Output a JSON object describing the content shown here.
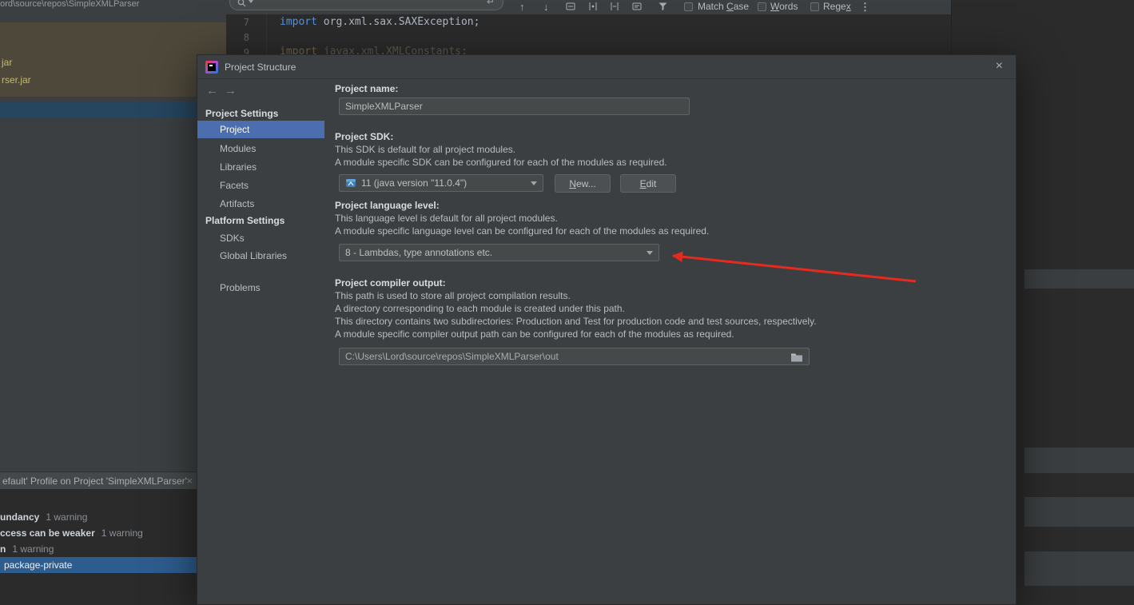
{
  "colors": {
    "panel_bg": "#3c3f41",
    "editor_bg": "#2b2b2b",
    "selection_blue": "#4b6eaf",
    "tree_selection_blue": "#26455f",
    "inspection_selection_blue": "#2d5c8e",
    "library_highlight_brown": "#4e483a",
    "jar_text_yellow": "#c5ba6a",
    "keyword_blue": "#5792d8",
    "arrow_red": "#e52a1e"
  },
  "icons": {
    "close": "×",
    "back": "←",
    "forward": "→",
    "up": "↑",
    "down": "↓",
    "enter": "↵",
    "more": "⋮"
  },
  "window": {
    "title": "Lord\\source\\repos\\SimpleXMLParser"
  },
  "find_bar": {
    "match_case": {
      "pre": "Match ",
      "key": "C",
      "post": "ase"
    },
    "words": {
      "pre": "",
      "key": "W",
      "post": "ords"
    },
    "regex": {
      "pre": "Rege",
      "key": "x",
      "post": ""
    }
  },
  "editor": {
    "line7": {
      "num": "7",
      "keyword": "import",
      "code": " org.xml.sax.SAXException;"
    },
    "line8": {
      "num": "8"
    },
    "line9": {
      "num": "9",
      "keyword": "import",
      "code": " javax.xml.XMLConstants;"
    }
  },
  "project_tree": {
    "jar1": "jar",
    "jar2": "rser.jar"
  },
  "inspections": {
    "tab_title": "efault' Profile on Project 'SimpleXMLParser'",
    "rows": [
      {
        "label": "undancy",
        "count": "1 warning"
      },
      {
        "label": "ccess can be weaker",
        "count": "1 warning"
      },
      {
        "label": "n",
        "count": "1 warning"
      },
      {
        "label": "package-private",
        "count": ""
      }
    ]
  },
  "dialog": {
    "title": "Project Structure",
    "sidebar": {
      "settings_header": "Project Settings",
      "items": [
        "Project",
        "Modules",
        "Libraries",
        "Facets",
        "Artifacts"
      ],
      "platform_header": "Platform Settings",
      "platform_items": [
        "SDKs",
        "Global Libraries"
      ],
      "problems": "Problems"
    },
    "name_label": "Project name:",
    "name_value": "SimpleXMLParser",
    "sdk_label": "Project SDK:",
    "sdk_desc1": "This SDK is default for all project modules.",
    "sdk_desc2": "A module specific SDK can be configured for each of the modules as required.",
    "sdk_value": "11 (java version \"11.0.4\")",
    "new_button": {
      "pre": "",
      "key": "N",
      "post": "ew..."
    },
    "edit_button": {
      "pre": "",
      "key": "E",
      "post": "dit"
    },
    "lang_label": "Project language level:",
    "lang_desc1": "This language level is default for all project modules.",
    "lang_desc2": "A module specific language level can be configured for each of the modules as required.",
    "lang_value": "8 - Lambdas, type annotations etc.",
    "out_label": "Project compiler output:",
    "out_desc1": "This path is used to store all project compilation results.",
    "out_desc2": "A directory corresponding to each module is created under this path.",
    "out_desc3": "This directory contains two subdirectories: Production and Test for production code and test sources, respectively.",
    "out_desc4": "A module specific compiler output path can be configured for each of the modules as required.",
    "out_value": "C:\\Users\\Lord\\source\\repos\\SimpleXMLParser\\out"
  }
}
